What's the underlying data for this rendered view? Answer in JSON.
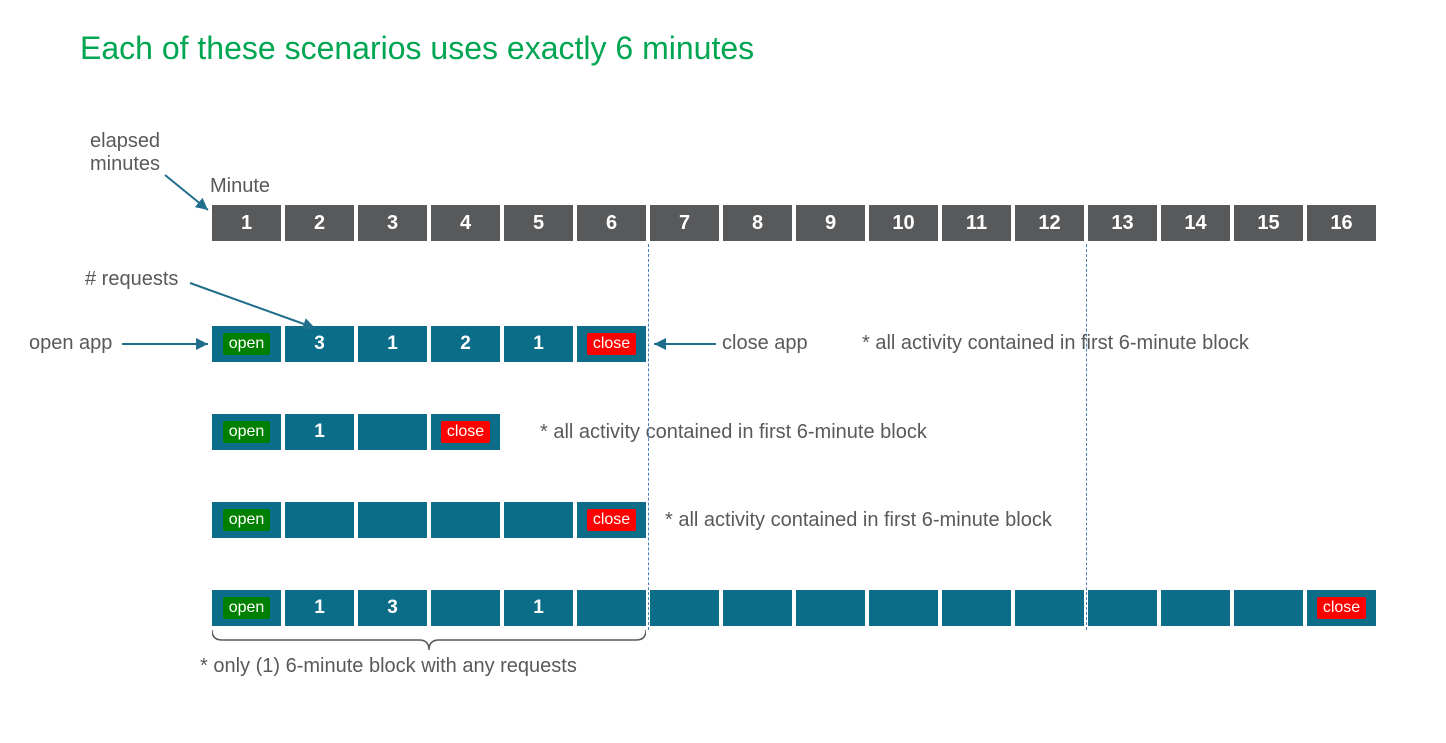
{
  "title": "Each of these scenarios uses exactly 6 minutes",
  "labels": {
    "elapsed_minutes": "elapsed\nminutes",
    "minute": "Minute",
    "num_requests": "# requests",
    "open_app": "open app",
    "close_app": "close app"
  },
  "minutes": [
    "1",
    "2",
    "3",
    "4",
    "5",
    "6",
    "7",
    "8",
    "9",
    "10",
    "11",
    "12",
    "13",
    "14",
    "15",
    "16"
  ],
  "open": "open",
  "close": "close",
  "scenarios": [
    {
      "cells": [
        "open",
        "3",
        "1",
        "2",
        "1",
        "close"
      ],
      "note": "* all activity contained in first 6-minute block"
    },
    {
      "cells": [
        "open",
        "1",
        "",
        "close"
      ],
      "note": "* all activity contained in first 6-minute block"
    },
    {
      "cells": [
        "open",
        "",
        "",
        "",
        "",
        "close"
      ],
      "note": "* all activity contained in first 6-minute block"
    },
    {
      "cells": [
        "open",
        "1",
        "3",
        "",
        "1",
        "",
        "",
        "",
        "",
        "",
        "",
        "",
        "",
        "",
        "",
        "close"
      ],
      "note": "* only (1) 6-minute block with any requests"
    }
  ]
}
